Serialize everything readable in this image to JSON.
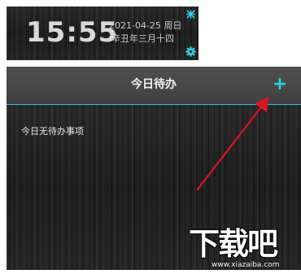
{
  "clock": {
    "time": "15:55",
    "date_weekday": "2021-04-25 周日",
    "lunar_date": "辛丑年三月十四",
    "pin_icon": "pin-icon",
    "settings_icon": "gear-icon"
  },
  "todo": {
    "title": "今日待办",
    "add_label": "+",
    "empty_message": "今日无待办事项",
    "accent_color": "#1ed8e6"
  },
  "annotation": {
    "arrow_color": "#e0141e"
  },
  "watermark": {
    "logo": "下载吧",
    "url": "www.xiazaiba.com"
  }
}
